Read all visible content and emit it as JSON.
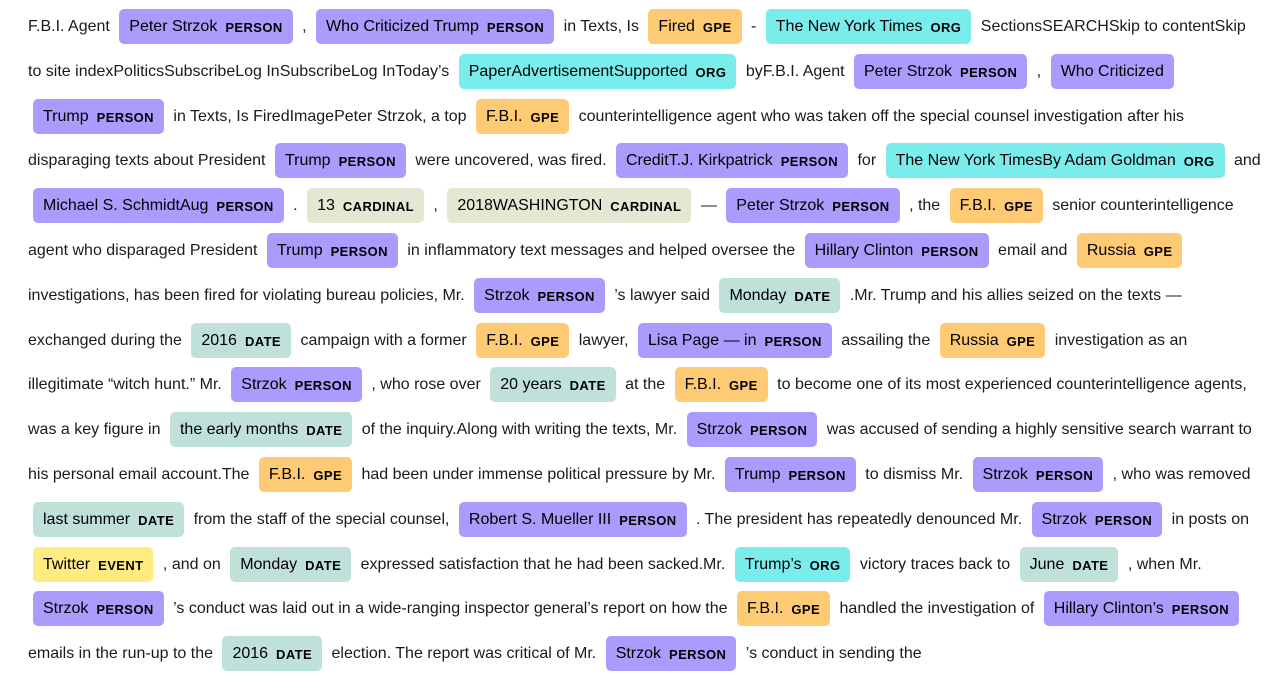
{
  "document": {
    "segments": [
      {
        "text": "F.B.I. Agent"
      },
      {
        "text": "Peter Strzok",
        "label": "PERSON"
      },
      {
        "text": ","
      },
      {
        "text": "Who Criticized Trump",
        "label": "PERSON"
      },
      {
        "text": "in Texts, Is"
      },
      {
        "text": "Fired",
        "label": "GPE"
      },
      {
        "text": "-"
      },
      {
        "text": "The New York Times",
        "label": "ORG"
      },
      {
        "text": "SectionsSEARCHSkip to contentSkip to site indexPoliticsSubscribeLog InSubscribeLog InToday’s"
      },
      {
        "text": "PaperAdvertisementSupported",
        "label": "ORG"
      },
      {
        "text": "byF.B.I. Agent"
      },
      {
        "text": "Peter Strzok",
        "label": "PERSON"
      },
      {
        "text": ","
      },
      {
        "text": "Who Criticized Trump",
        "label": "PERSON"
      },
      {
        "text": "in Texts, Is FiredImagePeter Strzok, a top"
      },
      {
        "text": "F.B.I.",
        "label": "GPE"
      },
      {
        "text": "counterintelligence agent who was taken off the special counsel investigation after his disparaging texts about President"
      },
      {
        "text": "Trump",
        "label": "PERSON"
      },
      {
        "text": "were uncovered, was fired."
      },
      {
        "text": "CreditT.J. Kirkpatrick",
        "label": "PERSON"
      },
      {
        "text": "for"
      },
      {
        "text": "The New York TimesBy Adam Goldman",
        "label": "ORG"
      },
      {
        "text": "and"
      },
      {
        "text": "Michael S. SchmidtAug",
        "label": "PERSON"
      },
      {
        "text": "."
      },
      {
        "text": "13",
        "label": "CARDINAL"
      },
      {
        "text": ","
      },
      {
        "text": "2018WASHINGTON",
        "label": "CARDINAL"
      },
      {
        "text": "—"
      },
      {
        "text": "Peter Strzok",
        "label": "PERSON"
      },
      {
        "text": ", the"
      },
      {
        "text": "F.B.I.",
        "label": "GPE"
      },
      {
        "text": "senior counterintelligence agent who disparaged President"
      },
      {
        "text": "Trump",
        "label": "PERSON"
      },
      {
        "text": "in inflammatory text messages and helped oversee the"
      },
      {
        "text": "Hillary Clinton",
        "label": "PERSON"
      },
      {
        "text": "email and"
      },
      {
        "text": "Russia",
        "label": "GPE"
      },
      {
        "text": "investigations, has been fired for violating bureau policies, Mr."
      },
      {
        "text": "Strzok",
        "label": "PERSON"
      },
      {
        "text": "’s lawyer said"
      },
      {
        "text": "Monday",
        "label": "DATE"
      },
      {
        "text": ".Mr. Trump and his allies seized on the texts — exchanged during the"
      },
      {
        "text": "2016",
        "label": "DATE"
      },
      {
        "text": "campaign with a former"
      },
      {
        "text": "F.B.I.",
        "label": "GPE"
      },
      {
        "text": "lawyer,"
      },
      {
        "text": "Lisa Page — in",
        "label": "PERSON"
      },
      {
        "text": "assailing the"
      },
      {
        "text": "Russia",
        "label": "GPE"
      },
      {
        "text": "investigation as an illegitimate “witch hunt.” Mr."
      },
      {
        "text": "Strzok",
        "label": "PERSON"
      },
      {
        "text": ", who rose over"
      },
      {
        "text": "20 years",
        "label": "DATE"
      },
      {
        "text": "at the"
      },
      {
        "text": "F.B.I.",
        "label": "GPE"
      },
      {
        "text": "to become one of its most experienced counterintelligence agents, was a key figure in"
      },
      {
        "text": "the early months",
        "label": "DATE"
      },
      {
        "text": "of the inquiry.Along with writing the texts, Mr."
      },
      {
        "text": "Strzok",
        "label": "PERSON"
      },
      {
        "text": "was accused of sending a highly sensitive search warrant to his personal email account.The"
      },
      {
        "text": "F.B.I.",
        "label": "GPE"
      },
      {
        "text": "had been under immense political pressure by Mr."
      },
      {
        "text": "Trump",
        "label": "PERSON"
      },
      {
        "text": "to dismiss Mr."
      },
      {
        "text": "Strzok",
        "label": "PERSON"
      },
      {
        "text": ", who was removed"
      },
      {
        "text": "last summer",
        "label": "DATE"
      },
      {
        "text": "from the staff of the special counsel,"
      },
      {
        "text": "Robert S. Mueller III",
        "label": "PERSON"
      },
      {
        "text": ". The president has repeatedly denounced Mr."
      },
      {
        "text": "Strzok",
        "label": "PERSON"
      },
      {
        "text": "in posts on"
      },
      {
        "text": "Twitter",
        "label": "EVENT"
      },
      {
        "text": ", and on"
      },
      {
        "text": "Monday",
        "label": "DATE"
      },
      {
        "text": "expressed satisfaction that he had been sacked.Mr."
      },
      {
        "text": "Trump’s",
        "label": "ORG"
      },
      {
        "text": "victory traces back to"
      },
      {
        "text": "June",
        "label": "DATE"
      },
      {
        "text": ", when Mr."
      },
      {
        "text": "Strzok",
        "label": "PERSON"
      },
      {
        "text": "’s conduct was laid out in a wide-ranging inspector general’s report on how the"
      },
      {
        "text": "F.B.I.",
        "label": "GPE"
      },
      {
        "text": "handled the investigation of"
      },
      {
        "text": "Hillary Clinton’s",
        "label": "PERSON"
      },
      {
        "text": "emails in the run-up to the"
      },
      {
        "text": "2016",
        "label": "DATE"
      },
      {
        "text": "election. The report was critical of Mr."
      },
      {
        "text": "Strzok",
        "label": "PERSON"
      },
      {
        "text": "’s conduct in sending the"
      }
    ]
  },
  "entity_colors": {
    "PERSON": "#aa9cfc",
    "GPE": "#feca74",
    "ORG": "#7aecec",
    "DATE": "#bfe1d9",
    "CARDINAL": "#e4e7d2",
    "EVENT": "#ffeb80"
  }
}
